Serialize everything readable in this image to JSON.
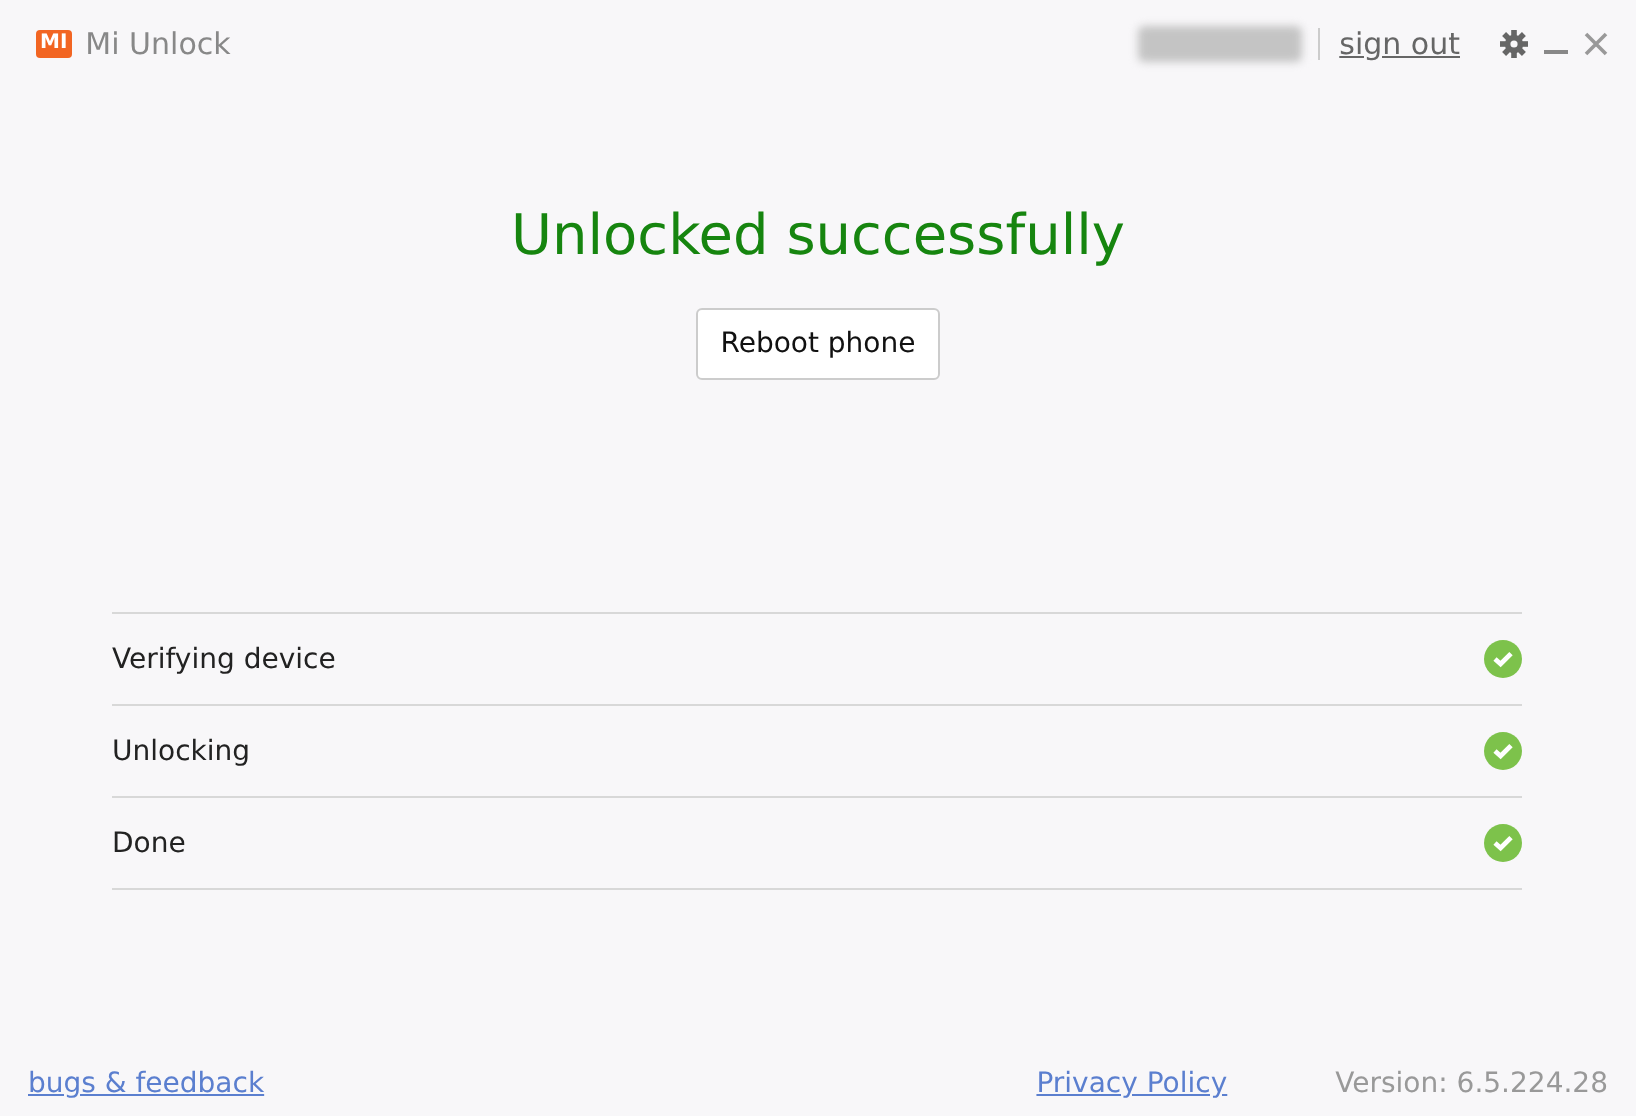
{
  "window": {
    "title": "Mi Unlock",
    "logo": "MI"
  },
  "header": {
    "sign_out": "sign out"
  },
  "status": {
    "title": "Unlocked successfully",
    "button": "Reboot phone"
  },
  "steps": [
    {
      "label": "Verifying device",
      "done": true
    },
    {
      "label": "Unlocking",
      "done": true
    },
    {
      "label": "Done",
      "done": true
    }
  ],
  "footer": {
    "feedback": "bugs & feedback",
    "privacy": "Privacy Policy",
    "version": "Version: 6.5.224.28"
  }
}
